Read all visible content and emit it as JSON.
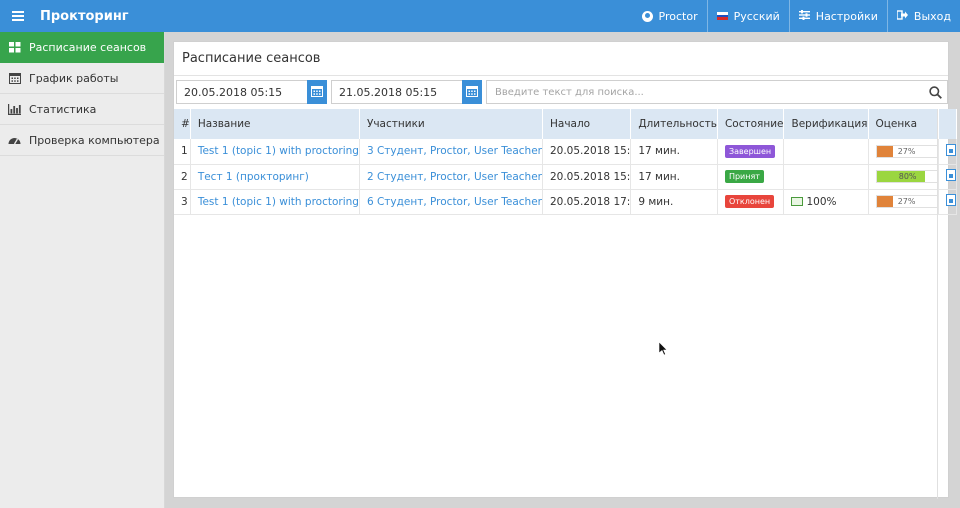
{
  "header": {
    "brand": "Прокторинг",
    "user": "Proctor",
    "language": "Русский",
    "settings": "Настройки",
    "logout": "Выход",
    "color": "#3a8fd8"
  },
  "sidebar": {
    "items": [
      {
        "label": "Расписание сеансов",
        "icon": "grid-icon",
        "active": true
      },
      {
        "label": "График работы",
        "icon": "calendar-icon",
        "active": false
      },
      {
        "label": "Статистика",
        "icon": "bar-chart-icon",
        "active": false
      },
      {
        "label": "Проверка компьютера",
        "icon": "dashboard-icon",
        "active": false
      }
    ]
  },
  "main": {
    "title": "Расписание сеансов",
    "date_from": "20.05.2018 05:15",
    "date_to": "21.05.2018 05:15",
    "search_placeholder": "Введите текст для поиска..."
  },
  "table": {
    "columns": [
      "#",
      "Название",
      "Участники",
      "Начало",
      "Длительность",
      "Состояние",
      "Верификация",
      "Оценка",
      ""
    ],
    "rows": [
      {
        "num": "1",
        "name": "Test 1 (topic 1) with proctoring",
        "participants": "3 Студент, Proctor, User Teacher",
        "start": "20.05.2018 15:",
        "duration": "17 мин.",
        "status": "Завершен",
        "status_color": "#8e57d8",
        "verification": "",
        "score": "27%",
        "score_value": 0.27,
        "score_color": "#e0833a"
      },
      {
        "num": "2",
        "name": "Тест 1 (прокторинг)",
        "participants": "2 Студент, Proctor, User Teacher",
        "start": "20.05.2018 15:",
        "duration": "17 мин.",
        "status": "Принят",
        "status_color": "#3aa845",
        "verification": "",
        "score": "80%",
        "score_value": 0.8,
        "score_color": "#9bd640"
      },
      {
        "num": "3",
        "name": "Test 1 (topic 1) with proctoring",
        "participants": "6 Студент, Proctor, User Teacher",
        "start": "20.05.2018 17:",
        "duration": "9 мин.",
        "status": "Отклонен",
        "status_color": "#e8453c",
        "verification": "100%",
        "score": "27%",
        "score_value": 0.27,
        "score_color": "#e0833a"
      }
    ]
  }
}
